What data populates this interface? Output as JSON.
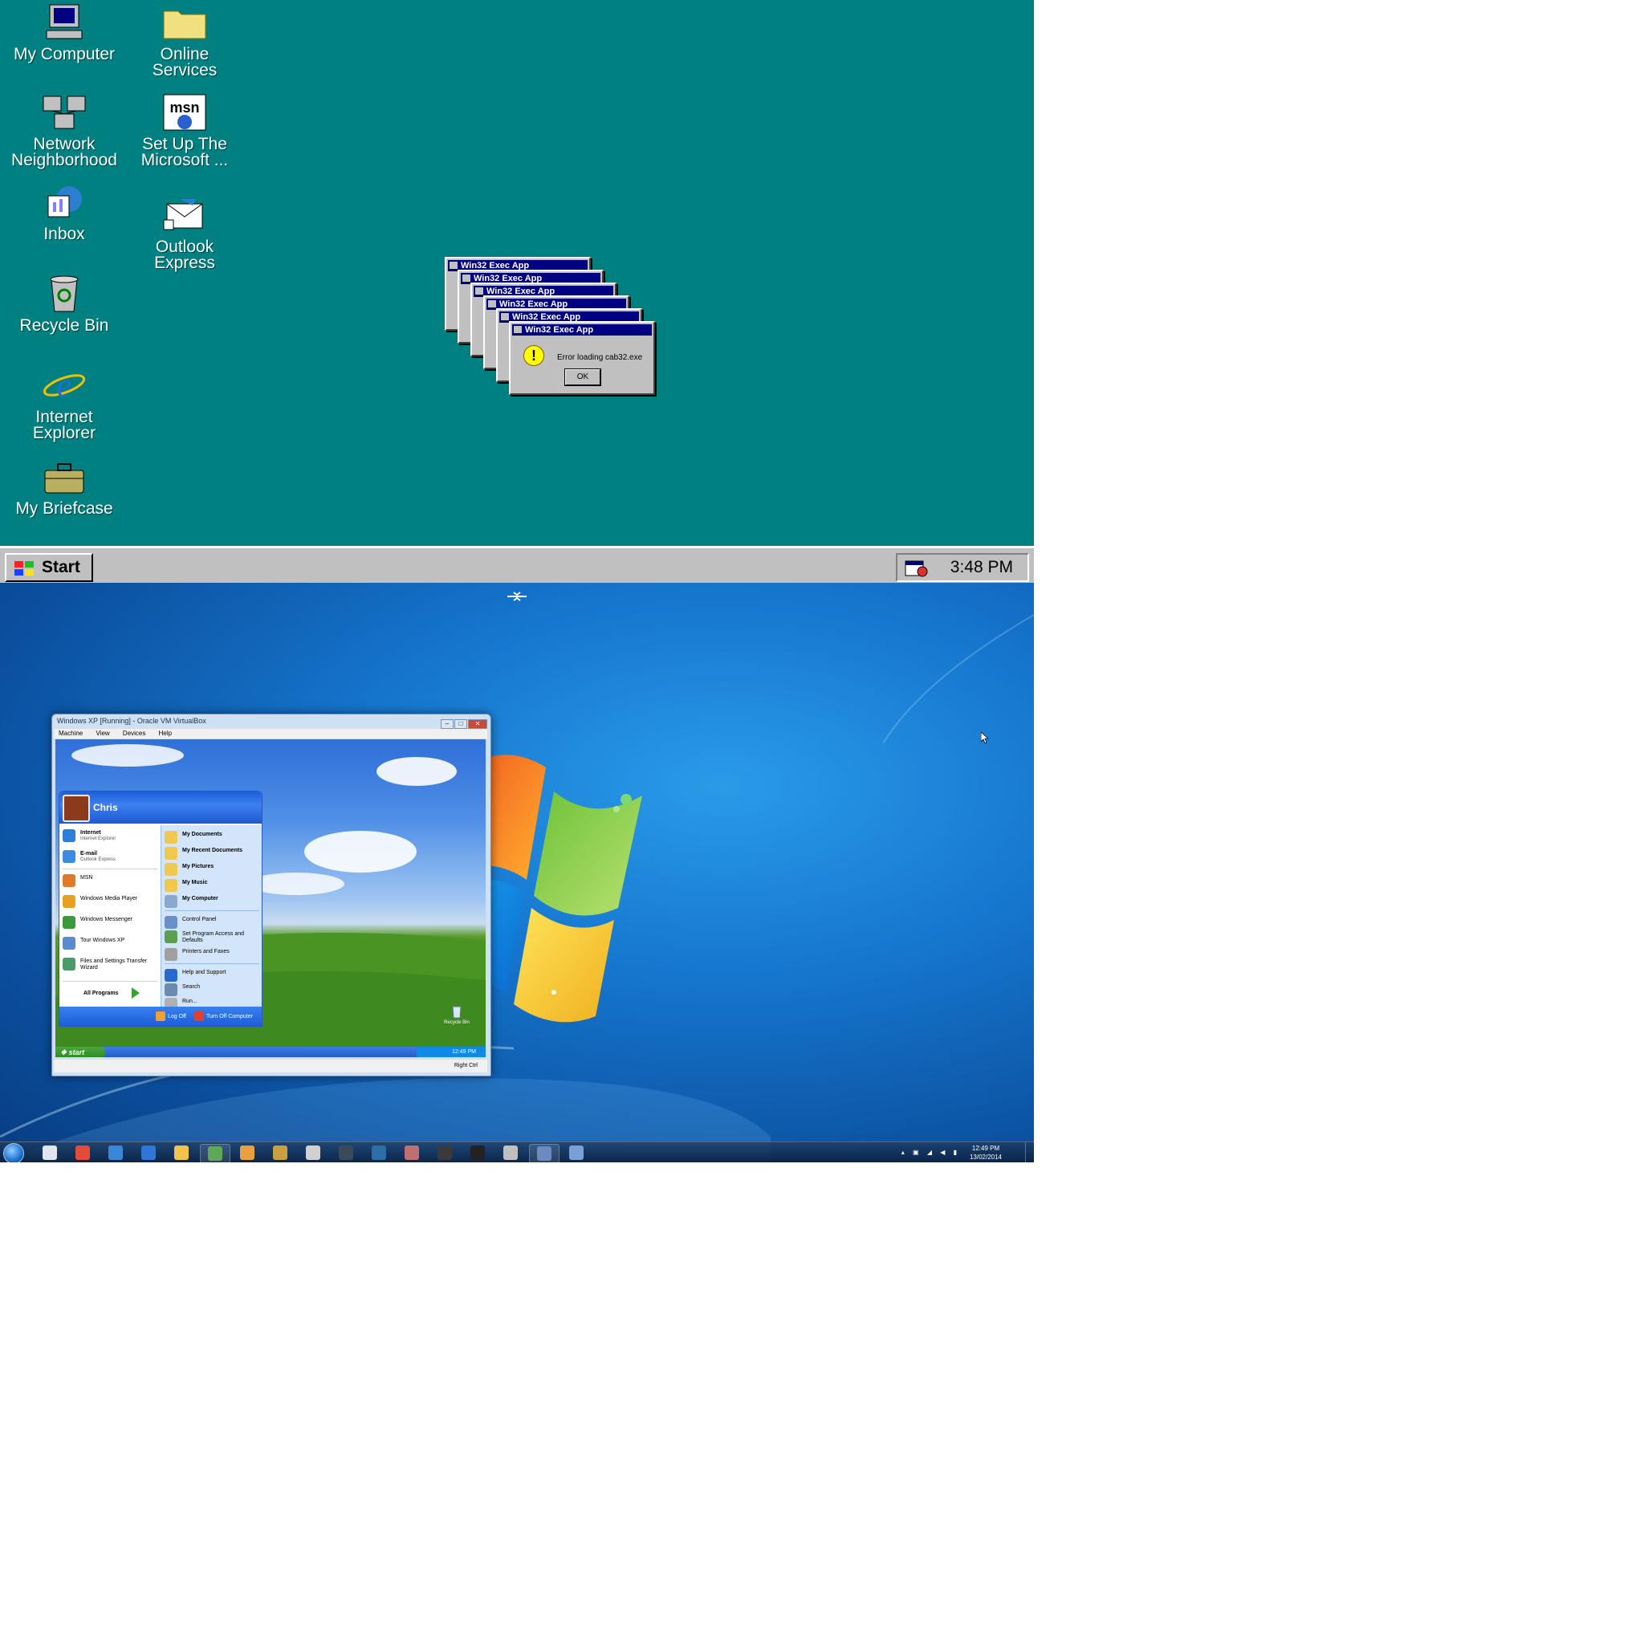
{
  "win95": {
    "desktop_icons": [
      {
        "label": "My Computer",
        "icon": "my-computer-icon"
      },
      {
        "label": "Online\nServices",
        "icon": "folder-icon"
      },
      {
        "label": "Network\nNeighborhood",
        "icon": "network-neighborhood-icon"
      },
      {
        "label": "Set Up The\nMicrosoft ...",
        "icon": "msn-icon"
      },
      {
        "label": "Inbox",
        "icon": "inbox-icon"
      },
      {
        "label": "Outlook\nExpress",
        "icon": "outlook-express-icon"
      },
      {
        "label": "Recycle Bin",
        "icon": "recycle-bin-icon"
      },
      {
        "label": "Internet\nExplorer",
        "icon": "internet-explorer-icon"
      },
      {
        "label": "My Briefcase",
        "icon": "briefcase-icon"
      }
    ],
    "dialogs": {
      "title": "Win32 Exec App",
      "message": "Error loading cab32.exe",
      "ok_label": "OK",
      "count": 6
    },
    "taskbar": {
      "start_label": "Start",
      "clock": "3:48 PM"
    },
    "colors": {
      "desktop": "#008080",
      "titlebar": "#000080",
      "face": "#c0c0c0"
    }
  },
  "win7": {
    "virtualbox": {
      "title": "Windows XP [Running] - Oracle VM VirtualBox",
      "menu": [
        "Machine",
        "View",
        "Devices",
        "Help"
      ],
      "status_hostkey": "Right Ctrl",
      "xp": {
        "user_name": "Chris",
        "pinned": [
          {
            "title": "Internet",
            "subtitle": "Internet Explorer",
            "icon": "internet-explorer-icon",
            "color": "#2b7fd8"
          },
          {
            "title": "E-mail",
            "subtitle": "Outlook Express",
            "icon": "email-icon",
            "color": "#3b8be0"
          }
        ],
        "recent": [
          {
            "title": "MSN",
            "icon": "msn-butterfly-icon",
            "color": "#e07a2a"
          },
          {
            "title": "Windows Media Player",
            "icon": "media-player-icon",
            "color": "#e8a020"
          },
          {
            "title": "Windows Messenger",
            "icon": "messenger-icon",
            "color": "#3a9a3a"
          },
          {
            "title": "Tour Windows XP",
            "icon": "tour-icon",
            "color": "#5a8ad0"
          },
          {
            "title": "Files and Settings Transfer Wizard",
            "icon": "transfer-wizard-icon",
            "color": "#4a9a6a"
          }
        ],
        "all_programs": "All Programs",
        "right_items": [
          {
            "title": "My Documents",
            "bold": true,
            "icon": "my-documents-icon"
          },
          {
            "title": "My Recent Documents",
            "bold": true,
            "icon": "recent-documents-icon"
          },
          {
            "title": "My Pictures",
            "bold": true,
            "icon": "my-pictures-icon"
          },
          {
            "title": "My Music",
            "bold": true,
            "icon": "my-music-icon"
          },
          {
            "title": "My Computer",
            "bold": true,
            "icon": "my-computer-icon"
          },
          {
            "title": "Control Panel",
            "bold": false,
            "icon": "control-panel-icon"
          },
          {
            "title": "Set Program Access and Defaults",
            "bold": false,
            "icon": "program-access-icon"
          },
          {
            "title": "Printers and Faxes",
            "bold": false,
            "icon": "printers-icon"
          },
          {
            "title": "Help and Support",
            "bold": false,
            "icon": "help-icon"
          },
          {
            "title": "Search",
            "bold": false,
            "icon": "search-icon"
          },
          {
            "title": "Run...",
            "bold": false,
            "icon": "run-icon"
          }
        ],
        "log_off": "Log Off",
        "turn_off": "Turn Off Computer",
        "start_label": "start",
        "clock": "12:49 PM",
        "recycle_label": "Recycle Bin"
      }
    },
    "taskbar": {
      "clock_time": "12:49 PM",
      "clock_date": "13/02/2014",
      "apps": [
        {
          "icon": "metro-app-icon",
          "color": "#dfe6ef"
        },
        {
          "icon": "chrome-icon",
          "color": "#e34b3a"
        },
        {
          "icon": "sync-icon",
          "color": "#3a86d8"
        },
        {
          "icon": "calendar-icon",
          "color": "#2f77d6"
        },
        {
          "icon": "explorer-folder-icon",
          "color": "#f1c24c"
        },
        {
          "icon": "vm-app-icon",
          "color": "#5fa85a"
        },
        {
          "icon": "paint-icon",
          "color": "#e8a040"
        },
        {
          "icon": "tools-icon",
          "color": "#c8a040"
        },
        {
          "icon": "editor-icon",
          "color": "#d0d0d0"
        },
        {
          "icon": "steam-icon",
          "color": "#3a4a5a"
        },
        {
          "icon": "photoshop-icon",
          "color": "#2d6ea8"
        },
        {
          "icon": "network-app-icon",
          "color": "#c07070"
        },
        {
          "icon": "game-icon",
          "color": "#3a3a3a"
        },
        {
          "icon": "terminal-icon",
          "color": "#222222"
        },
        {
          "icon": "shield-icon",
          "color": "#c0c0c0"
        },
        {
          "icon": "virtualbox-icon",
          "color": "#6a8ac0"
        },
        {
          "icon": "remote-desktop-icon",
          "color": "#7aa0d8"
        }
      ]
    }
  }
}
